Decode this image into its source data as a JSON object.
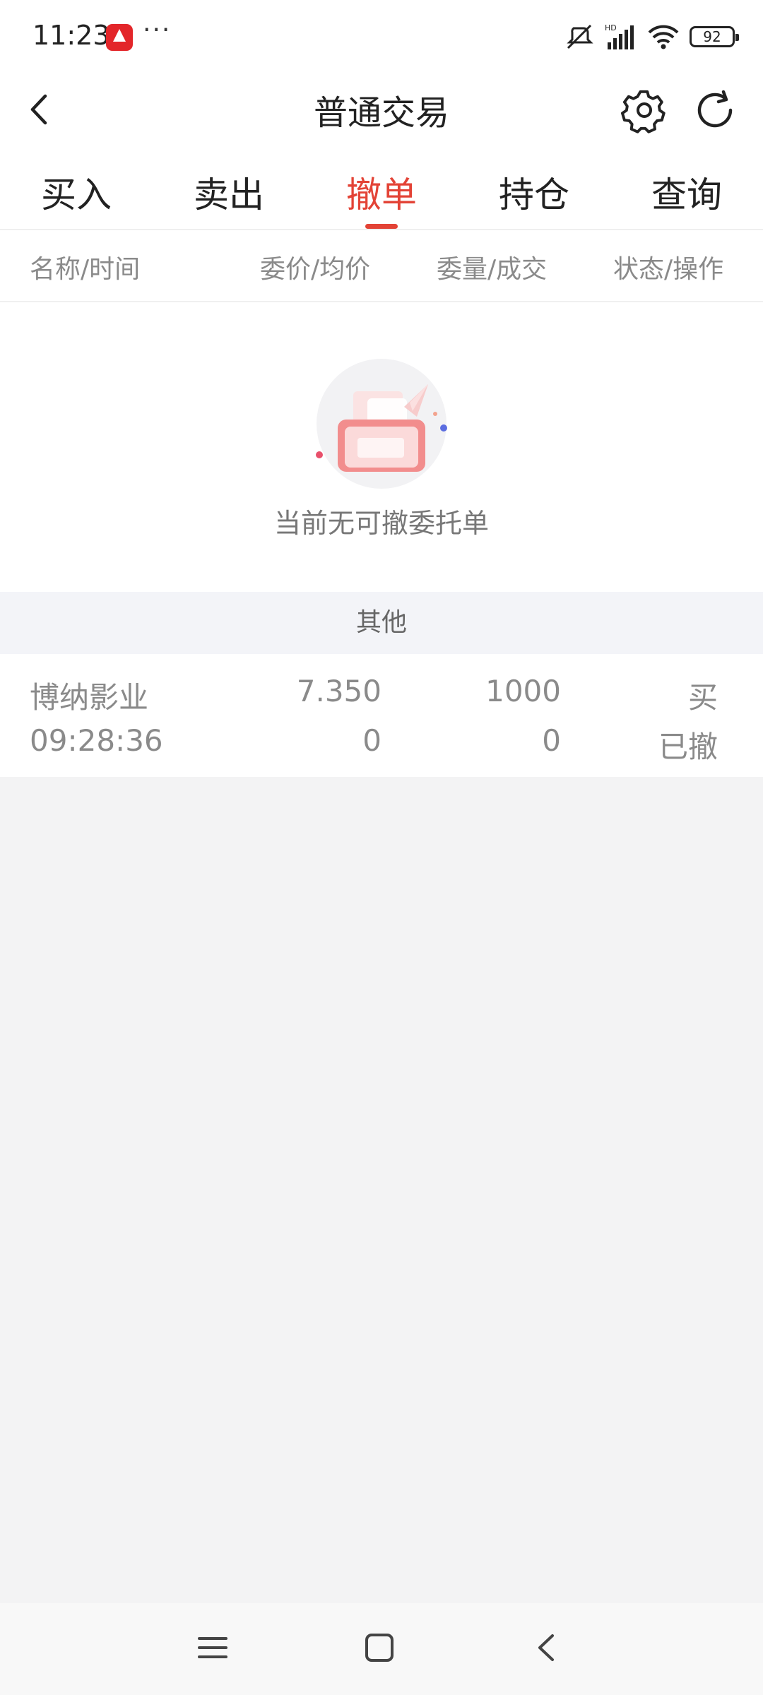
{
  "status_bar": {
    "time": "11:23",
    "more": "···",
    "battery": "92"
  },
  "header": {
    "title": "普通交易"
  },
  "tabs": [
    {
      "label": "买入"
    },
    {
      "label": "卖出"
    },
    {
      "label": "撤单",
      "active": true
    },
    {
      "label": "持仓"
    },
    {
      "label": "查询"
    }
  ],
  "table_header": {
    "col1": "名称/时间",
    "col2": "委价/均价",
    "col3": "委量/成交",
    "col4": "状态/操作"
  },
  "empty_state": {
    "message": "当前无可撤委托单"
  },
  "section": {
    "title": "其他"
  },
  "orders": [
    {
      "name": "博纳影业",
      "time": "09:28:36",
      "order_price": "7.350",
      "avg_price": "0",
      "order_qty": "1000",
      "filled_qty": "0",
      "direction": "买",
      "status": "已撤"
    }
  ],
  "colors": {
    "accent": "#e34336",
    "background": "#f3f3f4"
  }
}
